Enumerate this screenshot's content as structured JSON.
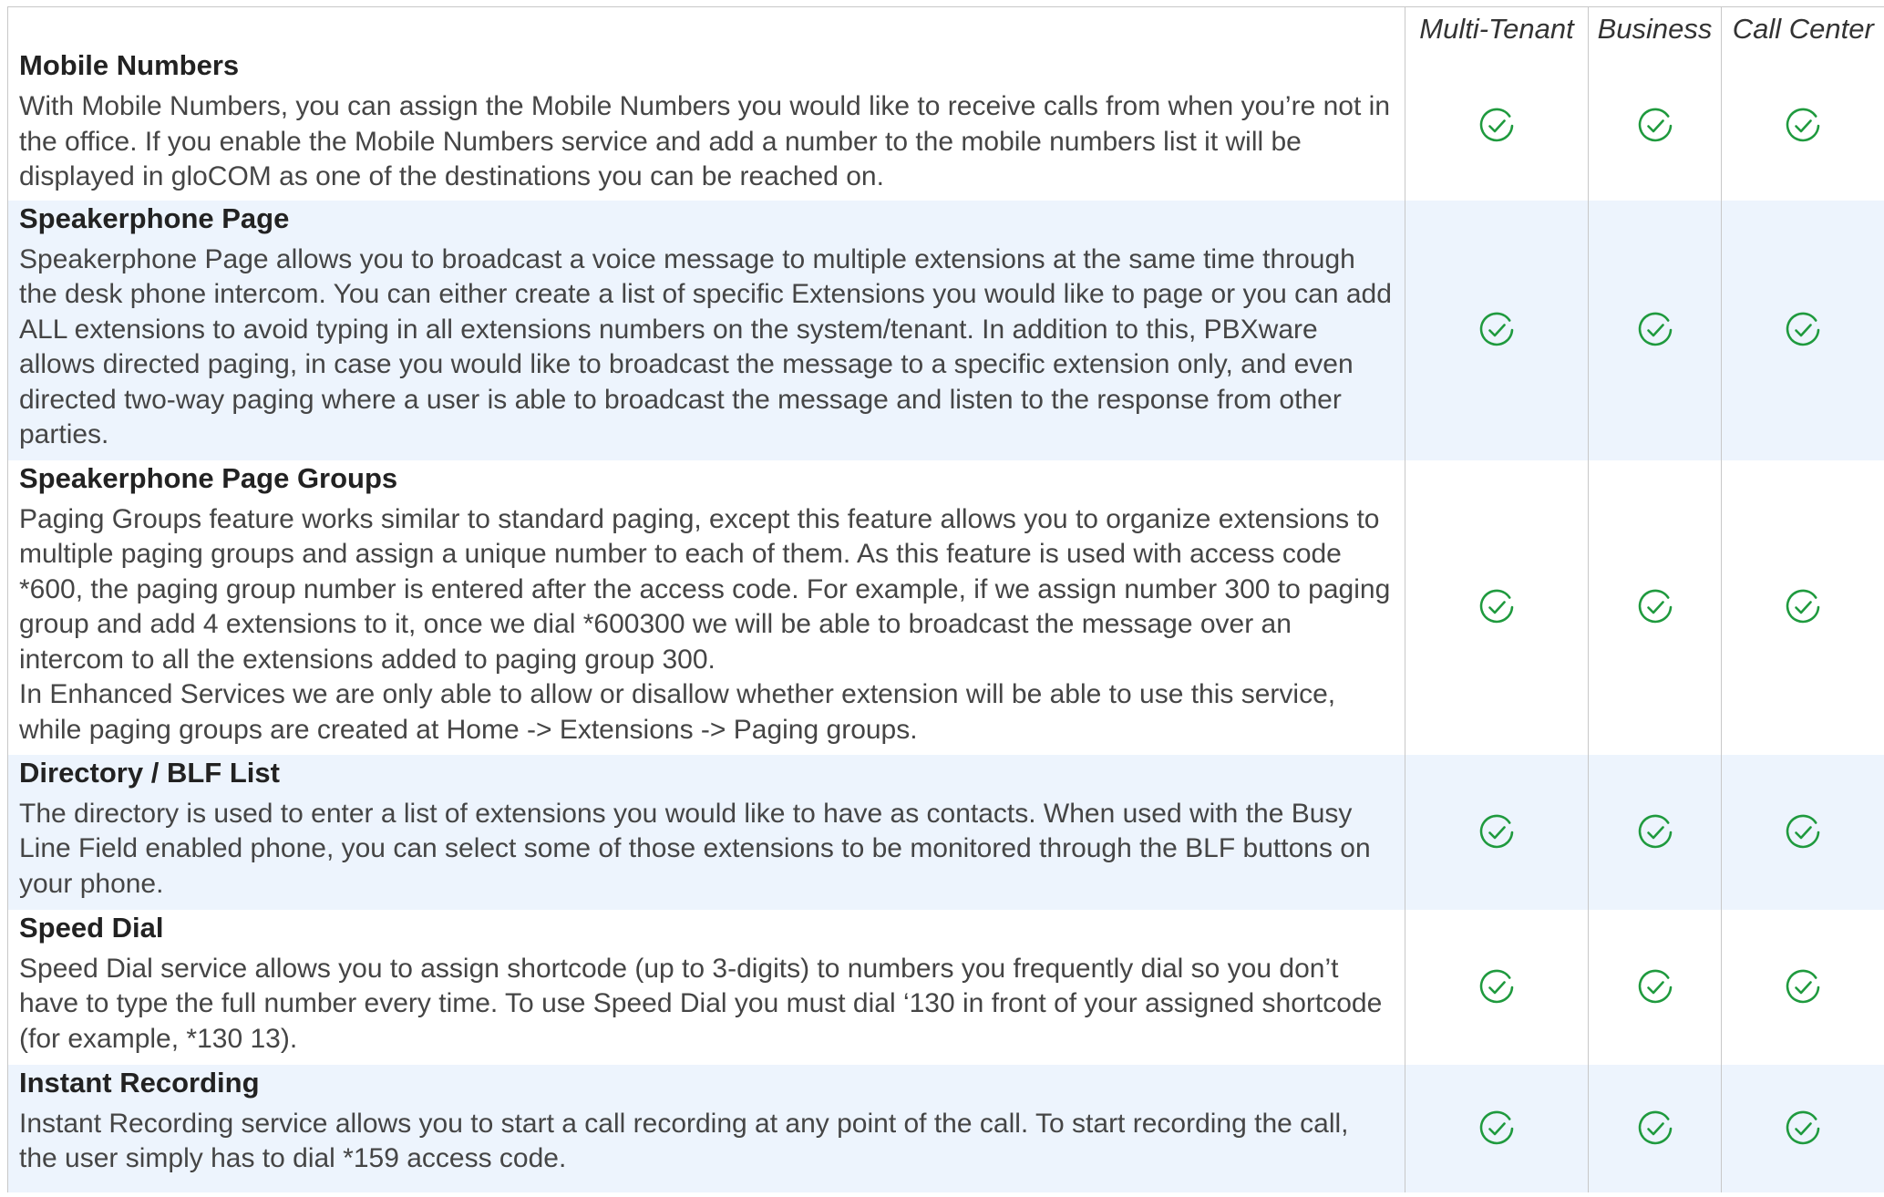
{
  "columns": {
    "multi_tenant": "Multi-Tenant",
    "business": "Business",
    "call_center": "Call Center"
  },
  "accent_color": "#1f9a3e",
  "row_shading": "#edf4fd",
  "features": [
    {
      "title": "Mobile Numbers",
      "paragraphs": [
        "With Mobile Numbers, you can assign the Mobile Numbers you would like to receive calls from when you’re not in the office. If you enable the Mobile Numbers service and add a number to the mobile numbers list it will be displayed in gloCOM as one of the destinations you can be reached on."
      ],
      "multi_tenant": "check-icon",
      "business": "check-icon",
      "call_center": "check-icon"
    },
    {
      "title": "Speakerphone Page",
      "paragraphs": [
        "Speakerphone Page allows you to broadcast a voice message to multiple extensions at the same time through the desk phone intercom. You can either create a list of specific Extensions you would like to page or you can add ALL extensions to avoid typing in all extensions numbers on the system/tenant. In addition to this, PBXware allows directed paging, in case you would like to broadcast the message to a specific extension only, and even directed two-way paging where a user is able to broadcast the message and listen to the response from other parties."
      ],
      "multi_tenant": "check-icon",
      "business": "check-icon",
      "call_center": "check-icon"
    },
    {
      "title": "Speakerphone Page Groups",
      "paragraphs": [
        "Paging Groups feature works similar to standard paging, except this feature allows you to organize extensions to multiple paging groups and assign a unique number to each of them. As this feature is used with access code *600, the paging group number is entered after the access code. For example, if we assign number 300 to paging group and add 4 extensions to it, once we dial *600300 we will be able to broadcast the message over an intercom to all the extensions added to paging group 300.",
        "In Enhanced Services we are only able to allow or disallow whether extension will be able to use this service, while paging groups are created at Home -> Extensions -> Paging groups."
      ],
      "multi_tenant": "check-icon",
      "business": "check-icon",
      "call_center": "check-icon"
    },
    {
      "title": "Directory / BLF List",
      "paragraphs": [
        "The directory is used to enter a list of extensions you would like to have as contacts. When used with the Busy Line Field enabled phone, you can select some of those extensions to be monitored through the BLF buttons on your phone."
      ],
      "multi_tenant": "check-icon",
      "business": "check-icon",
      "call_center": "check-icon"
    },
    {
      "title": "Speed Dial",
      "paragraphs": [
        "Speed Dial service allows you to assign shortcode (up to 3-digits) to numbers you frequently dial so you don’t have to type the full number every time. To use Speed Dial you must dial ‘130 in front of your assigned shortcode (for example, *130 13)."
      ],
      "multi_tenant": "check-icon",
      "business": "check-icon",
      "call_center": "check-icon"
    },
    {
      "title": "Instant Recording",
      "paragraphs": [
        "Instant Recording service allows you to start a call recording at any point of the call. To start recording the call, the user simply has to dial *159 access code."
      ],
      "multi_tenant": "check-icon",
      "business": "check-icon",
      "call_center": "check-icon"
    }
  ]
}
